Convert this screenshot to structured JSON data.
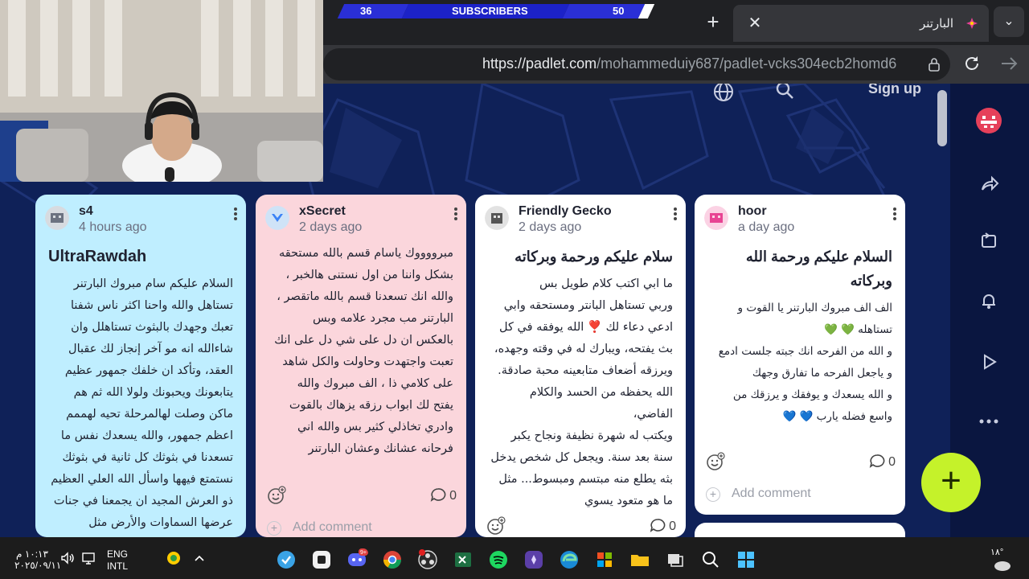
{
  "overlay": {
    "subscribers_left": "36",
    "subscribers_label": "SUBSCRIBERS",
    "subscribers_right": "50"
  },
  "browser": {
    "tab_title": "البارتنر",
    "url_host": "https://padlet.com",
    "url_path": "/mohammeduiy687/padlet-vcks304ecb2homd6"
  },
  "page": {
    "signup_label": "Sign up"
  },
  "cards": [
    {
      "author": "s4",
      "time": "4 hours ago",
      "title": "UltraRawdah",
      "body": [
        "السلام عليكم سام مبروك البارتنر",
        "تستاهل والله واحنا اكثر ناس شفنا",
        "تعبك وجهدك بالبثوث تستاهلل وان",
        "شاءالله انه مو آخر إنجاز لك عقبال",
        "العقد، وتأكد ان خلفك جمهور عظيم",
        "يتابعونك ويحبونك ولولا الله ثم هم",
        "ماكن وصلت لهالمرحلة تحيه لهممم",
        "اعظم جمهور، والله يسعدك نفس ما",
        "تسعدنا في بثوثك كل ثانية في بثوثك",
        "نستمتع فيهها واسأل الله العلي العظيم",
        "ذو العرش المجيد ان يجمعنا في جنات",
        "عرضها السماوات والأرض مثل"
      ]
    },
    {
      "author": "xSecret",
      "time": "2 days ago",
      "body": [
        "مبرووووك ياسام قسم بالله مستحقه",
        "بشكل واننا من اول نستنى هالخبر ،",
        "والله انك تسعدنا قسم بالله ماتقصر ،",
        "البارتنر مب مجرد علامه وبس",
        "بالعكس ان دل على شي دل على انك",
        "تعبت واجتهدت وحاولت والكل شاهد",
        "على كلامي ذا ، الف مبروك والله",
        "يفتح لك ابواب رزقه يزهاك بالقوت",
        "وادري تخاذلي كثير بس والله اني",
        "فرحانه عشانك وعشان البارتنر"
      ],
      "comments": "0",
      "add_comment": "Add comment"
    },
    {
      "author": "Friendly Gecko",
      "time": "2 days ago",
      "title": "سلام عليكم ورحمة وبركاته",
      "body": [
        "ما ابي اكتب كلام طويل بس",
        "وربي تستاهل البانتر ومستحقه وابي",
        "ادعي دعاء لك ❣️ الله يوفقه في كل",
        "بث يفتحه، ويبارك له في وقته وجهده،",
        "ويرزقه أضعاف متابعينه محبة صادقة.",
        "الله يحفظه من الحسد والكلام الفاضي،",
        "ويكتب له شهرة نظيفة ونجاح يكبر",
        "سنة بعد سنة. ويجعل كل شخص يدخل",
        "بثه يطلع منه مبتسم ومبسوط... مثل",
        "ما هو متعود يسوي"
      ],
      "comments": "0"
    },
    {
      "author": "hoor",
      "time": "a day ago",
      "title": "السلام عليكم ورحمة الله وبركاته",
      "body": [
        "الف الف مبروك البارتنر يا القوت و",
        "تستاهله 💚 💚",
        "و الله من الفرحه انك جبته جلست ادمع",
        "و ياجعل الفرحه ما تفارق وجهك",
        "و الله يسعدك و يوفقك و يرزقك من",
        "واسع فضله يارب 💙 💙"
      ],
      "comments": "0",
      "add_comment": "Add comment"
    }
  ],
  "taskbar": {
    "time": "١٠:١٣ م",
    "date": "٢٠٢٥/٠٩/١١",
    "lang_1": "ENG",
    "lang_2": "INTL",
    "temperature": "١٨°",
    "badge": "9+"
  },
  "colors": {
    "card_blue": "#bfeeff",
    "card_pink": "#fbd6dc",
    "card_white": "#ffffff",
    "fab": "#c5f22a",
    "page_bg": "#0f2158"
  }
}
